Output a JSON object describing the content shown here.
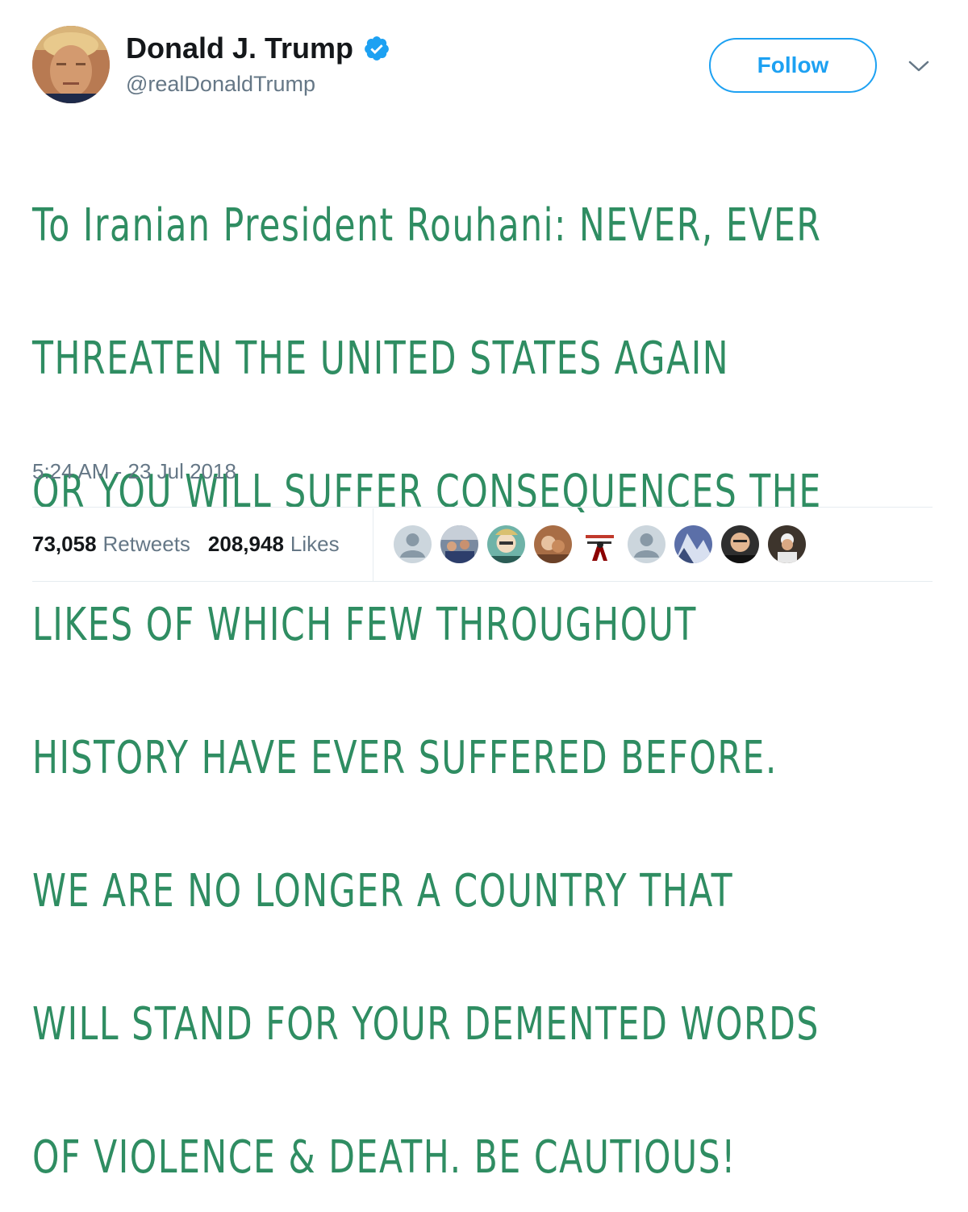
{
  "author": {
    "display_name": "Donald J. Trump",
    "handle": "@realDonaldTrump",
    "verified": true,
    "avatar_icon": "profile-photo",
    "verified_icon": "verified-badge-icon"
  },
  "follow_button": {
    "label": "Follow"
  },
  "menu_icon": "chevron-down-icon",
  "tweet": {
    "text_lines": [
      "To Iranian President Rouhani: NEVER, EVER",
      "THREATEN THE UNITED STATES AGAIN",
      "OR YOU WILL SUFFER CONSEQUENCES THE",
      "LIKES OF WHICH FEW THROUGHOUT",
      "HISTORY HAVE EVER SUFFERED BEFORE.",
      "WE ARE NO LONGER A COUNTRY THAT",
      "WILL STAND FOR YOUR DEMENTED WORDS",
      "OF VIOLENCE & DEATH. BE CAUTIOUS!"
    ],
    "timestamp": "5:24 AM - 23 Jul 2018"
  },
  "stats": {
    "retweets_count": "73,058",
    "retweets_label": "Retweets",
    "likes_count": "208,948",
    "likes_label": "Likes"
  },
  "likers": [
    {
      "kind": "default-avatar"
    },
    {
      "kind": "photo"
    },
    {
      "kind": "photo"
    },
    {
      "kind": "photo"
    },
    {
      "kind": "photo"
    },
    {
      "kind": "default-avatar"
    },
    {
      "kind": "photo"
    },
    {
      "kind": "photo"
    },
    {
      "kind": "photo"
    }
  ],
  "colors": {
    "accent": "#1da1f2",
    "text": "#14171a",
    "secondary_text": "#657786",
    "handwriting": "#2f8d62",
    "divider": "#e6ecf0"
  }
}
